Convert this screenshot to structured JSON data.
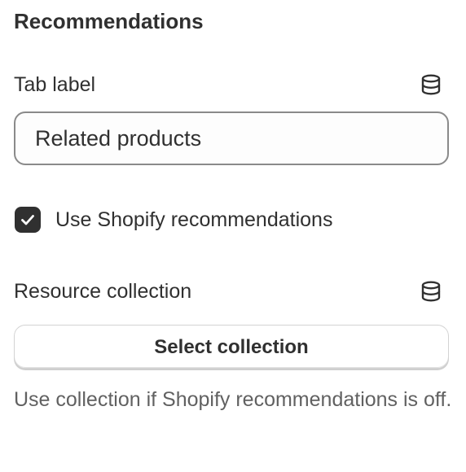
{
  "section": {
    "title": "Recommendations"
  },
  "tab_label_field": {
    "label": "Tab label",
    "value": "Related products",
    "icon": "database-icon"
  },
  "recommendations_checkbox": {
    "label": "Use Shopify recommendations",
    "checked": true
  },
  "resource_collection_field": {
    "label": "Resource collection",
    "icon": "database-icon",
    "button_label": "Select collection",
    "help_text": "Use collection if Shopify recommendations is off."
  },
  "colors": {
    "text": "#303030",
    "muted_text": "#616161",
    "input_border": "#8a8a8a",
    "checkbox_fill": "#303030"
  }
}
